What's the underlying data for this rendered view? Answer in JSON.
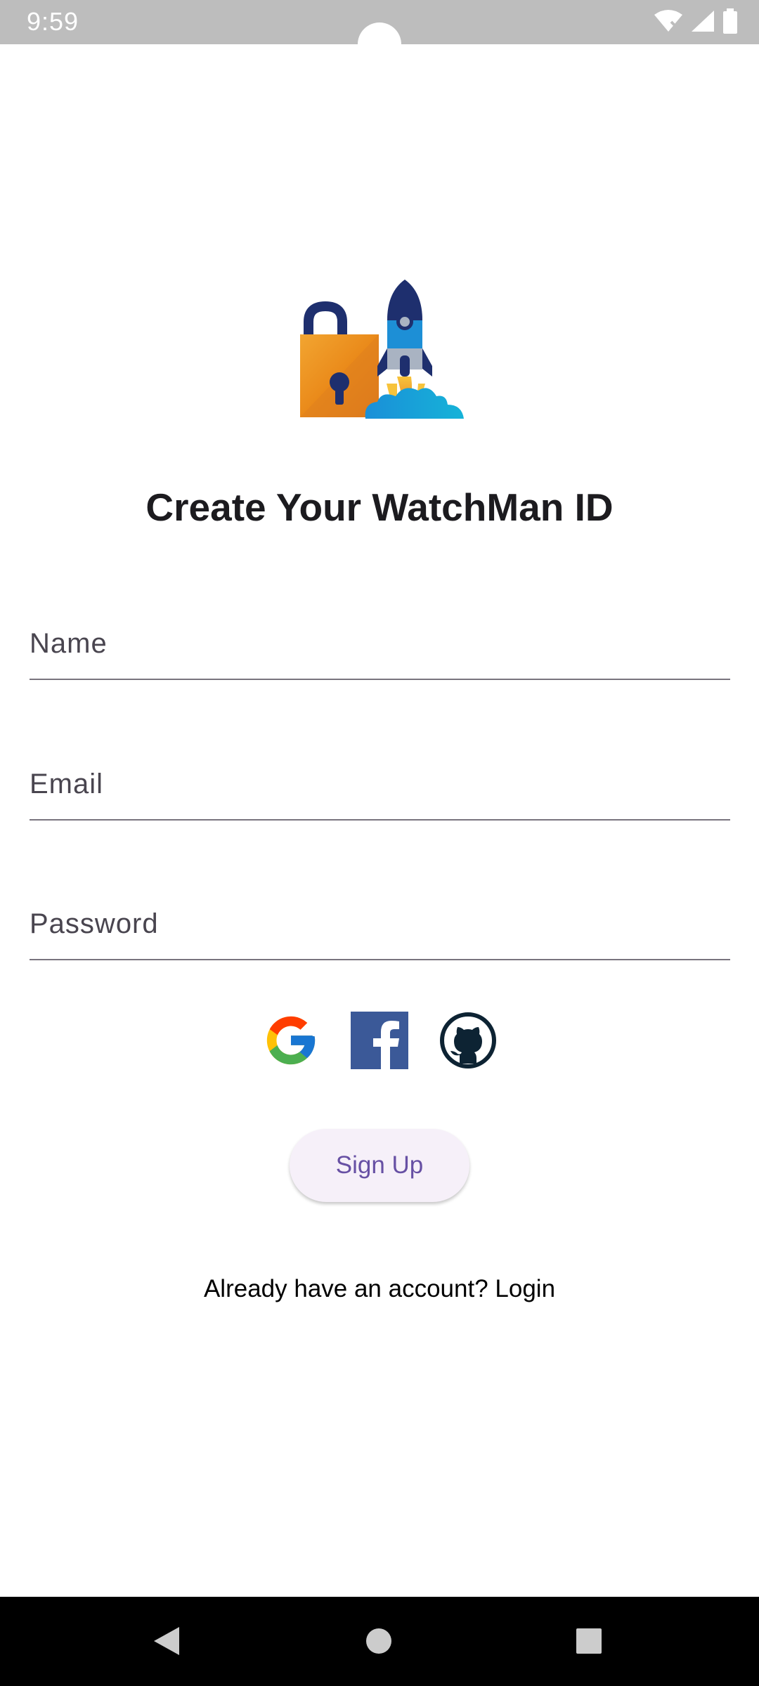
{
  "status_bar": {
    "time": "9:59",
    "icons": [
      "wifi-off-icon",
      "signal-icon",
      "battery-icon"
    ]
  },
  "illustration": {
    "icon": "lock-rocket-illustration"
  },
  "title": "Create Your WatchMan ID",
  "form": {
    "name_placeholder": "Name",
    "email_placeholder": "Email",
    "password_placeholder": "Password"
  },
  "social": {
    "icons": [
      "google-icon",
      "facebook-icon",
      "github-icon"
    ]
  },
  "signup_button": "Sign Up",
  "login_prompt": "Already have an account? Login",
  "nav_bar": {
    "icons": [
      "back-icon",
      "home-icon",
      "recent-apps-icon"
    ]
  },
  "colors": {
    "accent": "#6750a4",
    "button_bg": "#f6f0f9",
    "status_bar": "#bdbdbd",
    "nav_bar": "#000000"
  }
}
